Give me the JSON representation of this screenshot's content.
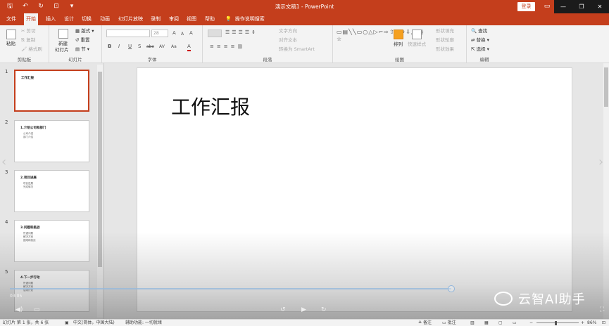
{
  "titlebar": {
    "qat": {
      "save": "🖫",
      "undo": "↶",
      "redo": "↻",
      "start": "⊡",
      "more": "▾"
    },
    "document_title": "演示文稿1  -  PowerPoint",
    "login_label": "登录",
    "ribbon_display_icon": "▭",
    "minimize": "—",
    "restore": "❐",
    "close": "✕"
  },
  "tabs": [
    "文件",
    "开始",
    "插入",
    "设计",
    "切换",
    "动画",
    "幻灯片放映",
    "录制",
    "审阅",
    "视图",
    "帮助"
  ],
  "tell_me": {
    "icon": "💡",
    "label": "操作说明搜索"
  },
  "ribbon": {
    "clipboard": {
      "label": "剪贴板",
      "paste": "粘贴",
      "cut": "剪切",
      "copy": "复制",
      "format_painter": "格式刷"
    },
    "slides": {
      "label": "幻灯片",
      "new_slide": "新建",
      "new_slide2": "幻灯片",
      "layout": "版式",
      "reset": "重置",
      "section": "节"
    },
    "font": {
      "label": "字体",
      "size": "28",
      "bold": "B",
      "italic": "I",
      "underline": "U",
      "strike": "S",
      "shadow": "abc",
      "spacing": "AV",
      "case": "Aa",
      "color": "A",
      "clear": "A",
      "grow": "A",
      "shrink": "A"
    },
    "paragraph": {
      "label": "段落",
      "text_dir": "文字方向",
      "align_text": "对齐文本",
      "smartart": "转换为 SmartArt"
    },
    "drawing": {
      "label": "绘图",
      "arrange": "排列",
      "quick_styles": "快速样式",
      "fill": "形状填充",
      "outline": "形状轮廓",
      "effects": "形状效果"
    },
    "editing": {
      "label": "编辑",
      "find": "查找",
      "replace": "替换",
      "select": "选择"
    }
  },
  "slides": [
    {
      "num": "1",
      "title": "工作汇报",
      "bullets": []
    },
    {
      "num": "2",
      "title": "1.介绍公司和部门",
      "bullets": [
        "公司介绍",
        "部门介绍"
      ]
    },
    {
      "num": "3",
      "title": "2.项目进展",
      "bullets": [
        "项目进展",
        "完成情况"
      ]
    },
    {
      "num": "4",
      "title": "3.问题和挑战",
      "bullets": [
        "所遇问题",
        "解决方案",
        "困难和挑战"
      ]
    },
    {
      "num": "5",
      "title": "4.下一步行动",
      "bullets": [
        "所遇问题",
        "解决方案",
        "后续计划"
      ]
    }
  ],
  "current_slide": {
    "title": "工作汇报"
  },
  "video": {
    "time": "03:05",
    "progress": 0.75,
    "watermark": "云智AI助手"
  },
  "statusbar": {
    "slide_info": "幻灯片 第 1 张，共 6 张",
    "language": "中文(简体，中国大陆)",
    "accessibility": "辅助功能: 一切就绪",
    "notes": "备注",
    "comments": "批注",
    "zoom": "86%"
  }
}
